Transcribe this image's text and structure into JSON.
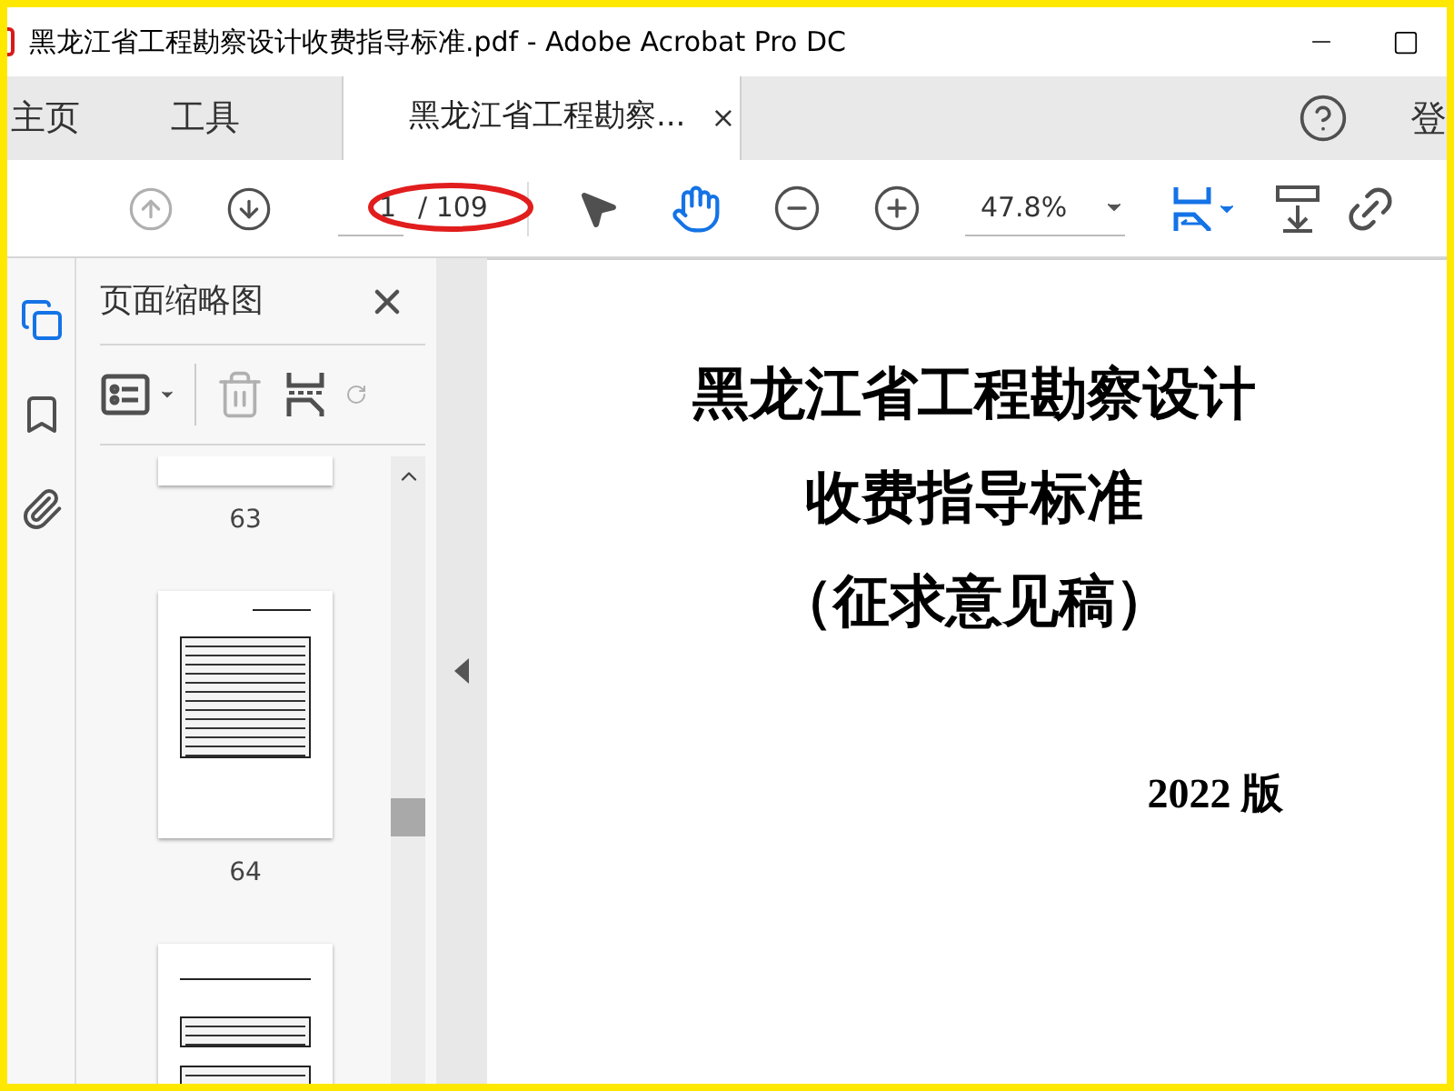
{
  "window": {
    "title": "黑龙江省工程勘察设计收费指导标准.pdf - Adobe Acrobat Pro DC"
  },
  "tabs": [
    {
      "label": "主页",
      "kind": "nav",
      "selected": false
    },
    {
      "label": "工具",
      "kind": "nav",
      "selected": false
    },
    {
      "label": "黑龙江省工程勘察...",
      "kind": "document",
      "selected": true,
      "close": "×"
    }
  ],
  "account": {
    "label": "登"
  },
  "toolbar": {
    "page_input": "1",
    "page_total": "/ 109",
    "zoom": "47.8%"
  },
  "rail": [
    {
      "kind": "pages",
      "selected": true
    },
    {
      "kind": "bookmarks",
      "selected": false
    },
    {
      "kind": "attachments",
      "selected": false
    }
  ],
  "panel": {
    "title": "页面缩略图",
    "thumbnails": [
      {
        "label": "63",
        "kind": "cut"
      },
      {
        "label": "64",
        "kind": "table"
      },
      {
        "kind": "tables"
      }
    ]
  },
  "document": {
    "title_lines": [
      "黑龙江省工程勘察设计",
      "收费指导标准",
      "（征求意见稿）"
    ],
    "edition": "2022 版"
  }
}
